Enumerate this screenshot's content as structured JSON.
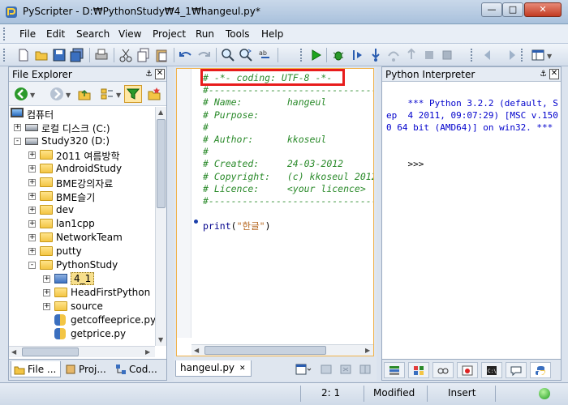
{
  "window": {
    "title": "PyScripter - D:₩PythonStudy₩4_1₩hangeul.py*"
  },
  "menu": [
    "File",
    "Edit",
    "Search",
    "View",
    "Project",
    "Run",
    "Tools",
    "Help"
  ],
  "file_explorer": {
    "title": "File Explorer",
    "tree": [
      {
        "label": "컴퓨터",
        "level": 0,
        "expander": "",
        "icon": "computer-icon"
      },
      {
        "label": "로컬 디스크 (C:)",
        "level": 1,
        "expander": "+",
        "icon": "drive-icon"
      },
      {
        "label": "Study320 (D:)",
        "level": 1,
        "expander": "-",
        "icon": "drive-icon"
      },
      {
        "label": "2011 여름방학",
        "level": 2,
        "expander": "+",
        "icon": "folder-icon"
      },
      {
        "label": "AndroidStudy",
        "level": 2,
        "expander": "+",
        "icon": "folder-icon"
      },
      {
        "label": "BME강의자료",
        "level": 2,
        "expander": "+",
        "icon": "folder-icon"
      },
      {
        "label": "BME슬기",
        "level": 2,
        "expander": "+",
        "icon": "folder-icon"
      },
      {
        "label": "dev",
        "level": 2,
        "expander": "+",
        "icon": "folder-icon"
      },
      {
        "label": "lan1cpp",
        "level": 2,
        "expander": "+",
        "icon": "folder-icon"
      },
      {
        "label": "NetworkTeam",
        "level": 2,
        "expander": "+",
        "icon": "folder-icon"
      },
      {
        "label": "putty",
        "level": 2,
        "expander": "+",
        "icon": "folder-icon"
      },
      {
        "label": "PythonStudy",
        "level": 2,
        "expander": "-",
        "icon": "folder-icon"
      },
      {
        "label": "4_1",
        "level": 3,
        "expander": "+",
        "icon": "open-folder-icon",
        "selected": true
      },
      {
        "label": "HeadFirstPython",
        "level": 3,
        "expander": "+",
        "icon": "folder-icon"
      },
      {
        "label": "source",
        "level": 3,
        "expander": "+",
        "icon": "folder-icon"
      },
      {
        "label": "getcoffeeprice.py",
        "level": 3,
        "expander": "",
        "icon": "python-file-icon"
      },
      {
        "label": "getprice.py",
        "level": 3,
        "expander": "",
        "icon": "python-file-icon"
      }
    ],
    "tabs": [
      "File ...",
      "Proj...",
      "Cod..."
    ]
  },
  "editor": {
    "tab_label": "hangeul.py",
    "lines": [
      {
        "text": "# -*- coding: UTF-8 -*-",
        "cls": "cm"
      },
      {
        "text": "#-------------------------------------",
        "cls": "cm"
      },
      {
        "text": "# Name:        hangeul",
        "cls": "cm"
      },
      {
        "text": "# Purpose:",
        "cls": "cm"
      },
      {
        "text": "#",
        "cls": "cm"
      },
      {
        "text": "# Author:      kkoseul",
        "cls": "cm"
      },
      {
        "text": "#",
        "cls": "cm"
      },
      {
        "text": "# Created:     24-03-2012",
        "cls": "cm"
      },
      {
        "text": "# Copyright:   (c) kkoseul 2012",
        "cls": "cm"
      },
      {
        "text": "# Licence:     <your licence>",
        "cls": "cm"
      },
      {
        "text": "#-------------------------------------",
        "cls": "cm"
      },
      {
        "text": "",
        "cls": ""
      },
      {
        "text": "",
        "cls": "print"
      }
    ],
    "print_fn": "print",
    "print_open": "(",
    "print_str": "\"한글\"",
    "print_close": ")"
  },
  "interpreter": {
    "title": "Python Interpreter",
    "banner": "*** Python 3.2.2 (default, Sep  4 2011, 09:07:29) [MSC v.1500 64 bit (AMD64)] on win32. ***",
    "prompt": ">>>"
  },
  "status": {
    "position": "2:  1",
    "state": "Modified",
    "mode": "Insert"
  },
  "colors": {
    "highlight_box": "#e81c1c",
    "comment": "#2a8a2a",
    "interpreter_text": "#0000cc"
  }
}
